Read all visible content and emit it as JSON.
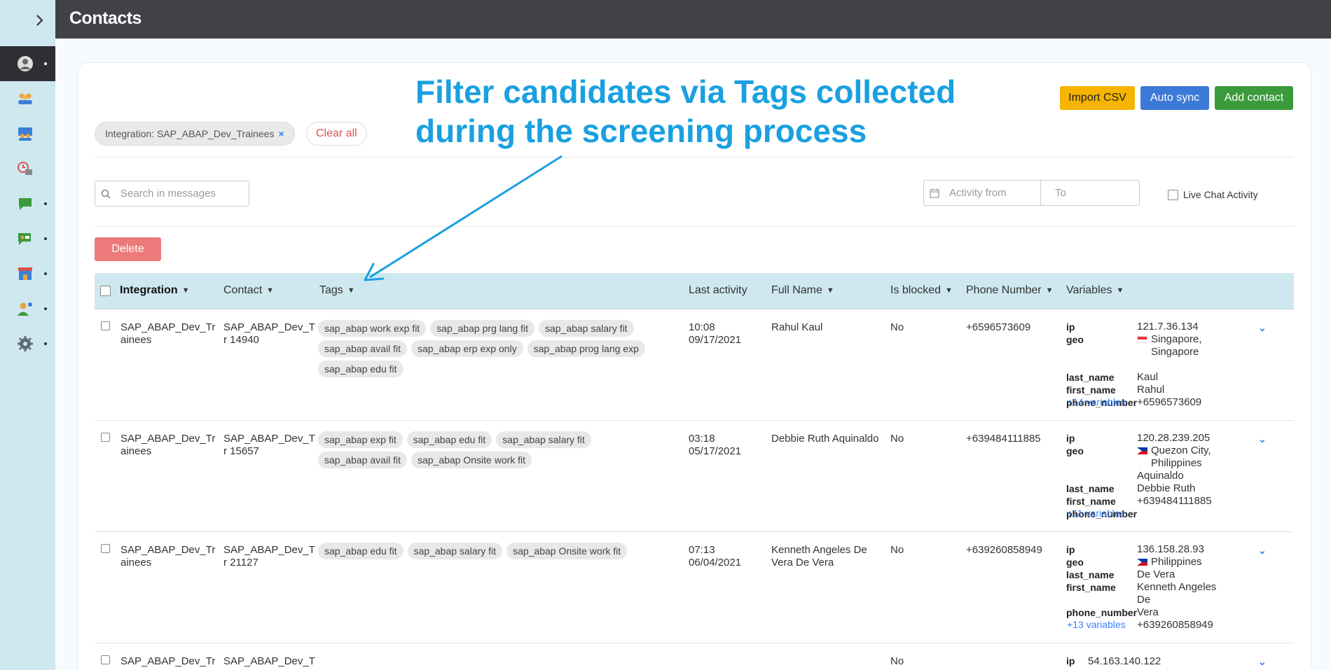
{
  "header": {
    "title": "Contacts"
  },
  "sidebar": {
    "items": [
      {
        "icon": "avatar-icon",
        "active": true
      },
      {
        "icon": "users-icon"
      },
      {
        "icon": "team-icon"
      },
      {
        "icon": "clock-icon"
      },
      {
        "icon": "chat-icon"
      },
      {
        "icon": "live-chat-icon"
      },
      {
        "icon": "store-icon"
      },
      {
        "icon": "agent-icon"
      },
      {
        "icon": "gear-icon"
      }
    ]
  },
  "filters": {
    "chip_label": "Integration: SAP_ABAP_Dev_Trainees",
    "chip_remove": "×",
    "clear_all": "Clear all"
  },
  "actions": {
    "import_csv": "Import CSV",
    "auto_sync": "Auto sync",
    "add_contact": "Add contact",
    "delete": "Delete"
  },
  "search": {
    "placeholder": "Search in messages"
  },
  "date": {
    "from_placeholder": "Activity from",
    "to_placeholder": "To"
  },
  "live_chat": {
    "label": "Live Chat Activity"
  },
  "annotation": {
    "line1": "Filter candidates via Tags collected",
    "line2": "during the screening process"
  },
  "table": {
    "headers": {
      "integration": "Integration",
      "contact": "Contact",
      "tags": "Tags",
      "last_activity": "Last activity",
      "full_name": "Full Name",
      "is_blocked": "Is blocked",
      "phone": "Phone Number",
      "variables": "Variables"
    },
    "rows": [
      {
        "integration_l1": "SAP_ABAP_Dev_Tr",
        "integration_l2": "ainees",
        "contact_l1": "SAP_ABAP_Dev_T",
        "contact_l2": "r 14940",
        "tags": [
          "sap_abap work exp fit",
          "sap_abap prg lang fit",
          "sap_abap salary fit",
          "sap_abap avail fit",
          "sap_abap erp exp only",
          "sap_abap prog lang exp",
          "sap_abap edu fit"
        ],
        "time": "10:08",
        "date": "09/17/2021",
        "full_name": "Rahul Kaul",
        "blocked": "No",
        "phone": "+6596573609",
        "var_keys": [
          "ip",
          "geo",
          "",
          "last_name",
          "first_name",
          "phone_number"
        ],
        "ip": "121.7.36.134",
        "geo_l1": "Singapore,",
        "geo_l2": "Singapore",
        "last_name": "Kaul",
        "first_name": "Rahul",
        "phone_number": "+6596573609",
        "more": "+14 variables"
      },
      {
        "integration_l1": "SAP_ABAP_Dev_Tr",
        "integration_l2": "ainees",
        "contact_l1": "SAP_ABAP_Dev_T",
        "contact_l2": "r 15657",
        "tags": [
          "sap_abap exp fit",
          "sap_abap edu fit",
          "sap_abap salary fit",
          "sap_abap avail fit",
          "sap_abap Onsite work fit"
        ],
        "time": "03:18",
        "date": "05/17/2021",
        "full_name": "Debbie Ruth Aquinaldo",
        "blocked": "No",
        "phone": "+639484111885",
        "var_keys": [
          "ip",
          "geo",
          "",
          "last_name",
          "first_name",
          "phone_number"
        ],
        "ip": "120.28.239.205",
        "geo_l1": "Quezon City,",
        "geo_l2": "Philippines",
        "last_name": "Aquinaldo",
        "first_name": "Debbie Ruth",
        "phone_number": "+639484111885",
        "more": "+11 variables"
      },
      {
        "integration_l1": "SAP_ABAP_Dev_Tr",
        "integration_l2": "ainees",
        "contact_l1": "SAP_ABAP_Dev_T",
        "contact_l2": "r 21127",
        "tags": [
          "sap_abap edu fit",
          "sap_abap salary fit",
          "sap_abap Onsite work fit"
        ],
        "time": "07:13",
        "date": "06/04/2021",
        "full_name_l1": "Kenneth Angeles De",
        "full_name_l2": "Vera De Vera",
        "blocked": "No",
        "phone": "+639260858949",
        "var_keys": [
          "ip",
          "geo",
          "last_name",
          "first_name",
          "",
          "",
          "phone_number"
        ],
        "ip": "136.158.28.93",
        "geo_l1": "Philippines",
        "last_name": "De Vera",
        "first_name_l1": "Kenneth Angeles De",
        "first_name_l2": "Vera",
        "phone_number": "+639260858949",
        "more": "+13 variables"
      },
      {
        "integration_l1": "SAP_ABAP_Dev_Tr",
        "contact_l1": "SAP_ABAP_Dev_T",
        "blocked": "No",
        "var_keys": [
          "ip"
        ],
        "ip": "54.163.140.122"
      }
    ]
  },
  "colors": {
    "sidebar": "#cfe8ef",
    "topbar": "#424148",
    "annotation": "#1aa0e0",
    "link": "#3b82f6"
  }
}
